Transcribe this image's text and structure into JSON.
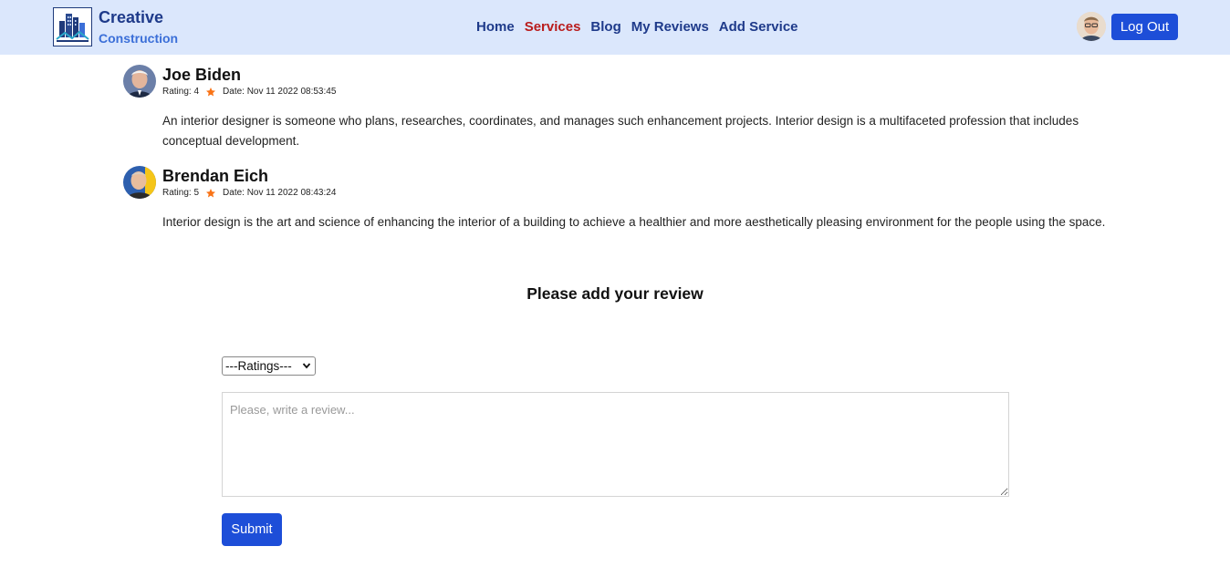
{
  "brand": {
    "title": "Creative",
    "subtitle": "Construction"
  },
  "nav": {
    "items": [
      {
        "label": "Home"
      },
      {
        "label": "Services"
      },
      {
        "label": "Blog"
      },
      {
        "label": "My Reviews"
      },
      {
        "label": "Add Service"
      }
    ],
    "active": "Services",
    "logout_label": "Log Out"
  },
  "reviews": [
    {
      "name": "Joe Biden",
      "rating_label": "Rating: 4",
      "date_label": "Date: Nov 11 2022 08:53:45",
      "text": "An interior designer is someone who plans, researches, coordinates, and manages such enhancement projects. Interior design is a multifaceted profession that includes conceptual development."
    },
    {
      "name": "Brendan Eich",
      "rating_label": "Rating: 5",
      "date_label": "Date: Nov 11 2022 08:43:24",
      "text": "Interior design is the art and science of enhancing the interior of a building to achieve a healthier and more aesthetically pleasing environment for the people using the space."
    }
  ],
  "add_review": {
    "title": "Please add your review",
    "rating_select_value": "---Ratings---",
    "textarea_placeholder": "Please, write a review...",
    "submit_label": "Submit"
  },
  "colors": {
    "navbar_bg": "#dbe7fc",
    "brand_dark": "#1e3a8a",
    "active_link": "#b91c1c",
    "button": "#1d4ed8",
    "star": "#f97316"
  }
}
